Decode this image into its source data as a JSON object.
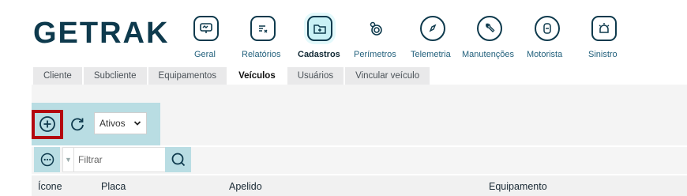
{
  "brand": {
    "logo_text": "GETRAK"
  },
  "nav": {
    "items": [
      {
        "label": "Geral",
        "icon": "monitor-icon",
        "active": false
      },
      {
        "label": "Relatórios",
        "icon": "report-icon",
        "active": false
      },
      {
        "label": "Cadastros",
        "icon": "folder-add-icon",
        "active": true
      },
      {
        "label": "Perímetros",
        "icon": "perimeter-icon",
        "active": false
      },
      {
        "label": "Telemetria",
        "icon": "compass-icon",
        "active": false
      },
      {
        "label": "Manutenções",
        "icon": "wrench-icon",
        "active": false
      },
      {
        "label": "Motorista",
        "icon": "driver-icon",
        "active": false
      },
      {
        "label": "Sinistro",
        "icon": "siren-icon",
        "active": false
      }
    ]
  },
  "subtabs": [
    {
      "label": "Cliente",
      "active": false
    },
    {
      "label": "Subcliente",
      "active": false
    },
    {
      "label": "Equipamentos",
      "active": false
    },
    {
      "label": "Veículos",
      "active": true
    },
    {
      "label": "Usuários",
      "active": false
    },
    {
      "label": "Vincular veículo",
      "active": false
    }
  ],
  "toolbar": {
    "add_icon": "plus-circle-icon",
    "refresh_icon": "refresh-icon",
    "status_value": "Ativos"
  },
  "filter": {
    "more_icon": "more-icon",
    "placeholder": "Filtrar",
    "search_icon": "search-icon"
  },
  "table": {
    "columns": [
      "Ícone",
      "Placa",
      "Apelido",
      "Equipamento"
    ]
  },
  "colors": {
    "primary_dark": "#0e3a4d",
    "accent_light": "#b9dde3",
    "highlight_border": "#b3060f"
  }
}
